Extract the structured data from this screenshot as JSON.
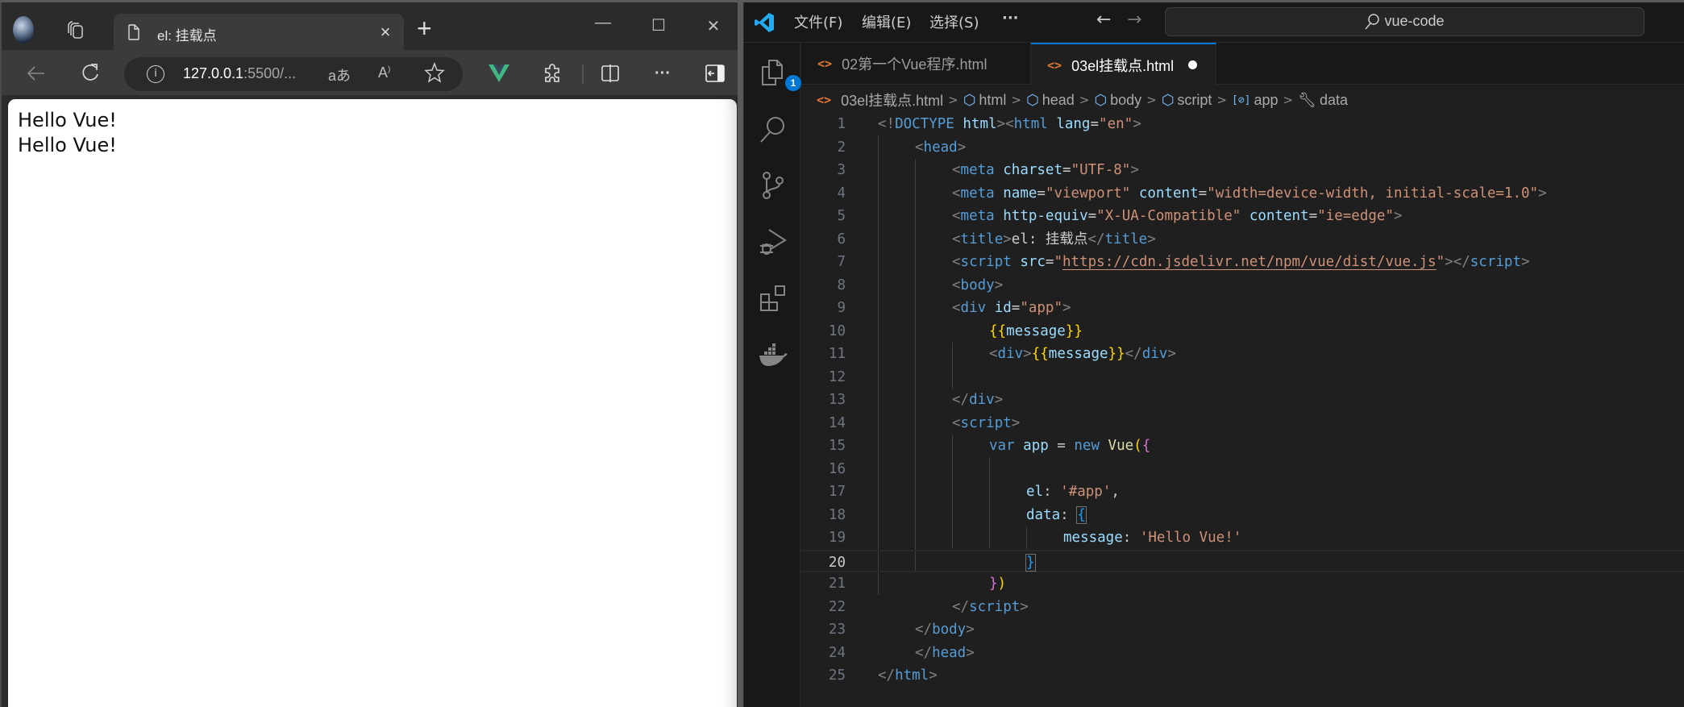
{
  "browser": {
    "tab_title": "el: 挂载点",
    "url_host": "127.0.0.1",
    "url_rest": ":5500/...",
    "toolbar_icons": [
      "back-icon",
      "refresh-icon",
      "info-icon",
      "read-aloud-icon",
      "favorite-star-icon",
      "vue-devtools-icon",
      "extensions-icon",
      "split-screen-icon",
      "more-icon",
      "sidebar-icon"
    ],
    "translate_label": "aあ",
    "read_aloud_label": "A",
    "window_controls": {
      "minimize": "—",
      "maximize": "☐",
      "close": "✕"
    },
    "page_lines": [
      "Hello Vue!",
      "Hello Vue!"
    ]
  },
  "vscode": {
    "menu": [
      "文件(F)",
      "编辑(E)",
      "选择(S)",
      "···"
    ],
    "search_label": "vue-code",
    "explorer_badge": "1",
    "activity_icons": [
      "explorer-icon",
      "search-icon",
      "source-control-icon",
      "run-debug-icon",
      "extensions-icon",
      "docker-icon"
    ],
    "tabs": [
      {
        "label": "02第一个Vue程序.html",
        "active": false,
        "dirty": false
      },
      {
        "label": "03el挂载点.html",
        "active": true,
        "dirty": true
      }
    ],
    "breadcrumb": [
      "03el挂载点.html",
      "html",
      "head",
      "body",
      "script",
      "app",
      "data"
    ],
    "current_line": 20,
    "code_lines": [
      {
        "n": "1"
      },
      {
        "n": "2"
      },
      {
        "n": "3"
      },
      {
        "n": "4"
      },
      {
        "n": "5"
      },
      {
        "n": "6"
      },
      {
        "n": "7"
      },
      {
        "n": "8"
      },
      {
        "n": "9"
      },
      {
        "n": "10"
      },
      {
        "n": "11"
      },
      {
        "n": "12"
      },
      {
        "n": "13"
      },
      {
        "n": "14"
      },
      {
        "n": "15"
      },
      {
        "n": "16"
      },
      {
        "n": "17"
      },
      {
        "n": "18"
      },
      {
        "n": "19"
      },
      {
        "n": "20"
      },
      {
        "n": "21"
      },
      {
        "n": "22"
      },
      {
        "n": "23"
      },
      {
        "n": "24"
      },
      {
        "n": "25"
      }
    ],
    "code": {
      "l1": [
        [
          "t-br",
          "<!"
        ],
        [
          "t-tag",
          "DOCTYPE"
        ],
        [
          "t-txt",
          " "
        ],
        [
          "t-attr",
          "html"
        ],
        [
          "t-br",
          "><"
        ],
        [
          "t-tag",
          "html"
        ],
        [
          "t-txt",
          " "
        ],
        [
          "t-attr",
          "lang"
        ],
        [
          "t-txt",
          "="
        ],
        [
          "t-str",
          "\"en\""
        ],
        [
          "t-br",
          ">"
        ]
      ],
      "l2": [
        [
          "t-br",
          "<"
        ],
        [
          "t-tag",
          "head"
        ],
        [
          "t-br",
          ">"
        ]
      ],
      "l3": [
        [
          "t-br",
          "<"
        ],
        [
          "t-tag",
          "meta"
        ],
        [
          "t-txt",
          " "
        ],
        [
          "t-attr",
          "charset"
        ],
        [
          "t-txt",
          "="
        ],
        [
          "t-str",
          "\"UTF-8\""
        ],
        [
          "t-br",
          ">"
        ]
      ],
      "l4": [
        [
          "t-br",
          "<"
        ],
        [
          "t-tag",
          "meta"
        ],
        [
          "t-txt",
          " "
        ],
        [
          "t-attr",
          "name"
        ],
        [
          "t-txt",
          "="
        ],
        [
          "t-str",
          "\"viewport\""
        ],
        [
          "t-txt",
          " "
        ],
        [
          "t-attr",
          "content"
        ],
        [
          "t-txt",
          "="
        ],
        [
          "t-str",
          "\"width=device-width, initial-scale=1.0\""
        ],
        [
          "t-br",
          ">"
        ]
      ],
      "l5": [
        [
          "t-br",
          "<"
        ],
        [
          "t-tag",
          "meta"
        ],
        [
          "t-txt",
          " "
        ],
        [
          "t-attr",
          "http-equiv"
        ],
        [
          "t-txt",
          "="
        ],
        [
          "t-str",
          "\"X-UA-Compatible\""
        ],
        [
          "t-txt",
          " "
        ],
        [
          "t-attr",
          "content"
        ],
        [
          "t-txt",
          "="
        ],
        [
          "t-str",
          "\"ie=edge\""
        ],
        [
          "t-br",
          ">"
        ]
      ],
      "l6": [
        [
          "t-br",
          "<"
        ],
        [
          "t-tag",
          "title"
        ],
        [
          "t-br",
          ">"
        ],
        [
          "t-txt",
          "el: 挂载点"
        ],
        [
          "t-br",
          "</"
        ],
        [
          "t-tag",
          "title"
        ],
        [
          "t-br",
          ">"
        ]
      ],
      "l7": [
        [
          "t-br",
          "<"
        ],
        [
          "t-tag",
          "script"
        ],
        [
          "t-txt",
          " "
        ],
        [
          "t-attr",
          "src"
        ],
        [
          "t-txt",
          "="
        ],
        [
          "t-str",
          "\""
        ],
        [
          "t-link",
          "https://cdn.jsdelivr.net/npm/vue/dist/vue.js"
        ],
        [
          "t-str",
          "\""
        ],
        [
          "t-br",
          "></"
        ],
        [
          "t-tag",
          "script"
        ],
        [
          "t-br",
          ">"
        ]
      ],
      "l8": [
        [
          "t-br",
          "<"
        ],
        [
          "t-tag",
          "body"
        ],
        [
          "t-br",
          ">"
        ]
      ],
      "l9": [
        [
          "t-br",
          "<"
        ],
        [
          "t-tag",
          "div"
        ],
        [
          "t-txt",
          " "
        ],
        [
          "t-attr",
          "id"
        ],
        [
          "t-txt",
          "="
        ],
        [
          "t-str",
          "\"app\""
        ],
        [
          "t-br",
          ">"
        ]
      ],
      "l10": [
        [
          "t-gold",
          "{{"
        ],
        [
          "t-var",
          "message"
        ],
        [
          "t-gold",
          "}}"
        ]
      ],
      "l11": [
        [
          "t-br",
          "<"
        ],
        [
          "t-tag",
          "div"
        ],
        [
          "t-br",
          ">"
        ],
        [
          "t-gold",
          "{{"
        ],
        [
          "t-var",
          "message"
        ],
        [
          "t-gold",
          "}}"
        ],
        [
          "t-br",
          "</"
        ],
        [
          "t-tag",
          "div"
        ],
        [
          "t-br",
          ">"
        ]
      ],
      "l12": [],
      "l13": [
        [
          "t-br",
          "</"
        ],
        [
          "t-tag",
          "div"
        ],
        [
          "t-br",
          ">"
        ]
      ],
      "l14": [
        [
          "t-br",
          "<"
        ],
        [
          "t-tag",
          "script"
        ],
        [
          "t-br",
          ">"
        ]
      ],
      "l15": [
        [
          "t-kw",
          "var"
        ],
        [
          "t-txt",
          " "
        ],
        [
          "t-var",
          "app"
        ],
        [
          "t-txt",
          " = "
        ],
        [
          "t-kw",
          "new"
        ],
        [
          "t-txt",
          " "
        ],
        [
          "t-cls",
          "Vue"
        ],
        [
          "t-gold",
          "("
        ],
        [
          "t-pink",
          "{"
        ]
      ],
      "l16": [],
      "l17": [
        [
          "t-var",
          "el"
        ],
        [
          "t-txt",
          ": "
        ],
        [
          "t-str",
          "'#app'"
        ],
        [
          "t-txt",
          ","
        ]
      ],
      "l18": [
        [
          "t-var",
          "data"
        ],
        [
          "t-txt",
          ": "
        ],
        [
          "t-blue",
          "{"
        ]
      ],
      "l19": [
        [
          "t-var",
          "message"
        ],
        [
          "t-txt",
          ": "
        ],
        [
          "t-str",
          "'Hello Vue!'"
        ]
      ],
      "l20": [
        [
          "t-blue",
          "}"
        ]
      ],
      "l21": [
        [
          "t-pink",
          "}"
        ],
        [
          "t-gold",
          ")"
        ]
      ],
      "l22": [
        [
          "t-br",
          "</"
        ],
        [
          "t-tag",
          "script"
        ],
        [
          "t-br",
          ">"
        ]
      ],
      "l23": [
        [
          "t-br",
          "</"
        ],
        [
          "t-tag",
          "body"
        ],
        [
          "t-br",
          ">"
        ]
      ],
      "l24": [
        [
          "t-br",
          "</"
        ],
        [
          "t-tag",
          "head"
        ],
        [
          "t-br",
          ">"
        ]
      ],
      "l25": [
        [
          "t-br",
          "</"
        ],
        [
          "t-tag",
          "html"
        ],
        [
          "t-br",
          ">"
        ]
      ]
    }
  }
}
